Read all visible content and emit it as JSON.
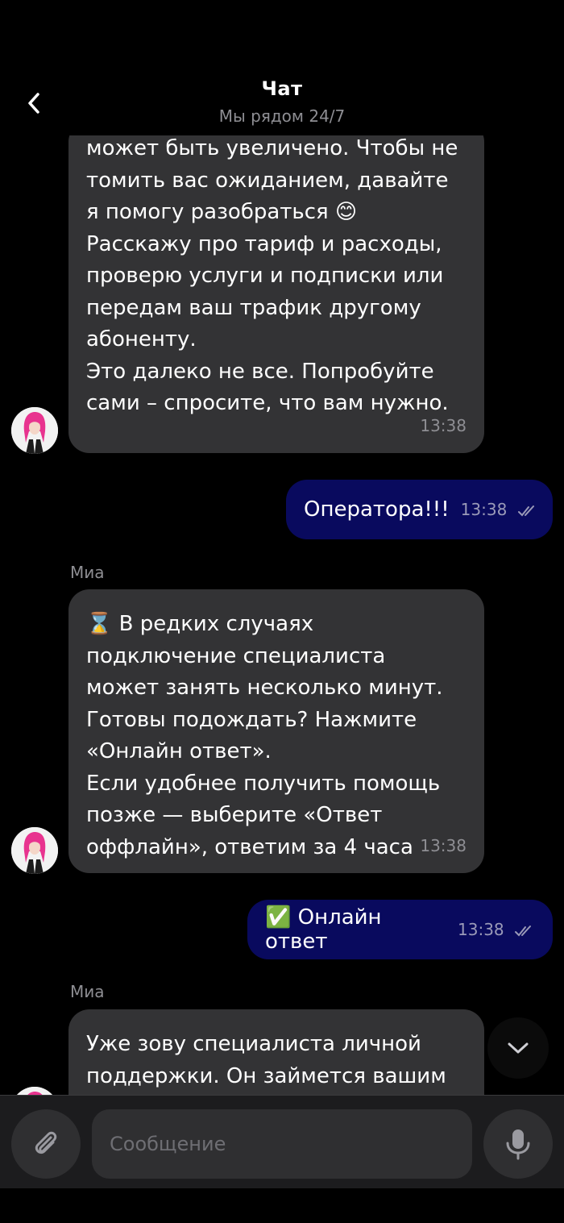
{
  "header": {
    "title": "Чат",
    "subtitle": "Мы рядом 24/7"
  },
  "messages": {
    "m1": {
      "lines": [
        "может быть увеличено. Чтобы не",
        "томить вас ожиданием, давайте",
        "я помогу разобраться 😊",
        "Расскажу про тариф и расходы,",
        "проверю услуги и подписки или",
        "передам ваш трафик другому",
        "абоненту.",
        "Это далеко не все. Попробуйте",
        "сами – спросите, что вам нужно."
      ],
      "time": "13:38"
    },
    "m2": {
      "text": "Оператора!!!",
      "time": "13:38"
    },
    "m3": {
      "sender": "Миа",
      "lines": [
        "⌛ В редких случаях",
        "подключение специалиста",
        "может занять несколько минут.",
        "Готовы подождать? Нажмите",
        "«Онлайн ответ».",
        "Если удобнее получить помощь",
        "позже — выберите «Ответ",
        "оффлайн», ответим за 4 часа"
      ],
      "time": "13:38"
    },
    "m4": {
      "text": "✅ Онлайн ответ",
      "time": "13:38"
    },
    "m5": {
      "sender": "Миа",
      "lines": [
        "Уже зову специалиста личной",
        "поддержки. Он займется вашим"
      ]
    }
  },
  "composer": {
    "placeholder": "Сообщение"
  },
  "colors": {
    "background": "#000000",
    "incoming_bubble": "#333335",
    "outgoing_bubble": "#090a5e"
  }
}
